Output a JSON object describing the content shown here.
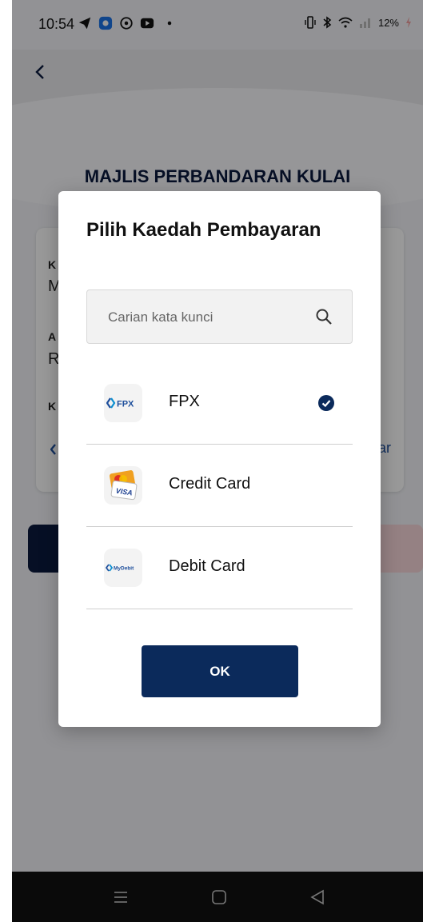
{
  "status_bar": {
    "time": "10:54",
    "battery": "12%",
    "icons": [
      "telegram-icon",
      "app-icon",
      "whatsapp-icon",
      "youtube-icon",
      "dot-icon",
      "vibrate-icon",
      "bluetooth-icon",
      "wifi-icon",
      "signal-icon",
      "battery-charging-icon"
    ]
  },
  "page": {
    "title": "MAJLIS PERBANDARAN KULAI",
    "card_fragments": {
      "label1": "K",
      "value1": "M",
      "label2": "A",
      "value2": "R",
      "label3": "K",
      "link_suffix": "ar"
    }
  },
  "modal": {
    "title": "Pilih Kaedah Pembayaran",
    "search_placeholder": "Carian kata kunci",
    "options": [
      {
        "label": "FPX",
        "logo_text": "FPX",
        "selected": true
      },
      {
        "label": "Credit Card",
        "logo_text": "VISA",
        "selected": false
      },
      {
        "label": "Debit Card",
        "logo_text": "MyDebit",
        "selected": false
      }
    ],
    "ok_label": "OK"
  },
  "colors": {
    "primary": "#0b2a5b",
    "title_navy": "#0b1a3e",
    "check": "#0b2a5b",
    "fpx_blue": "#1e4f9c",
    "overlay": "rgba(0,0,0,0.40)"
  },
  "nav_bar": {
    "icons": [
      "menu-icon",
      "home-icon",
      "back-icon"
    ]
  }
}
